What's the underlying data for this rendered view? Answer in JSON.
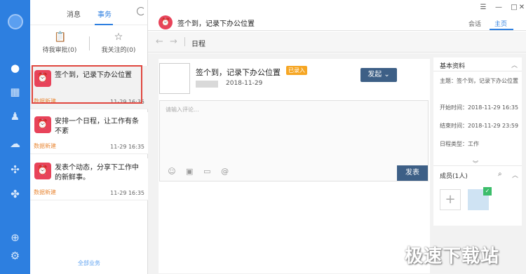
{
  "rail": {
    "icons": [
      "chat-icon",
      "calendar-icon",
      "contacts-icon",
      "cloud-icon",
      "apps-icon",
      "grid-icon",
      "add-icon",
      "settings-icon"
    ]
  },
  "list": {
    "tabs": [
      "消息",
      "事务"
    ],
    "active_tab": "事务",
    "filters": [
      {
        "label": "待我审批(0)",
        "icon": "clipboard-icon"
      },
      {
        "label": "我关注的(0)",
        "icon": "star-icon"
      }
    ],
    "items": [
      {
        "title": "签个到，记录下办公位置",
        "source": "数据新建",
        "time": "11-29 16:35"
      },
      {
        "title": "安排一个日程，让工作有条不紊",
        "source": "数据新建",
        "time": "11-29 16:35"
      },
      {
        "title": "发表个动态，分享下工作中的新鲜事。",
        "source": "数据新建",
        "time": "11-29 16:35"
      }
    ],
    "footer": "全部业务"
  },
  "header": {
    "title": "签个到，记录下办公位置",
    "tabs": [
      "会话",
      "主页"
    ],
    "active_tab": "主页"
  },
  "nav": {
    "breadcrumb": "日程"
  },
  "detail": {
    "title": "签个到，记录下办公位置",
    "badge": "已录入",
    "date": "2018-11-29",
    "launch_label": "发起",
    "comment_placeholder": "请输入评论...",
    "publish_label": "发表"
  },
  "info": {
    "header": "基本资料",
    "subject": "主题：签个到，记录下办公位置",
    "start": "开始时间：2018-11-29 16:35",
    "end": "结束时间：2018-11-29 23:59",
    "type": "日程类型：工作"
  },
  "members": {
    "title": "成员(1人)"
  },
  "watermark": "极速下载站",
  "colors": {
    "accent": "#2d7fe0",
    "brand_red": "#e8435a",
    "button_dark": "#3d5f86",
    "badge": "#f6a623"
  }
}
